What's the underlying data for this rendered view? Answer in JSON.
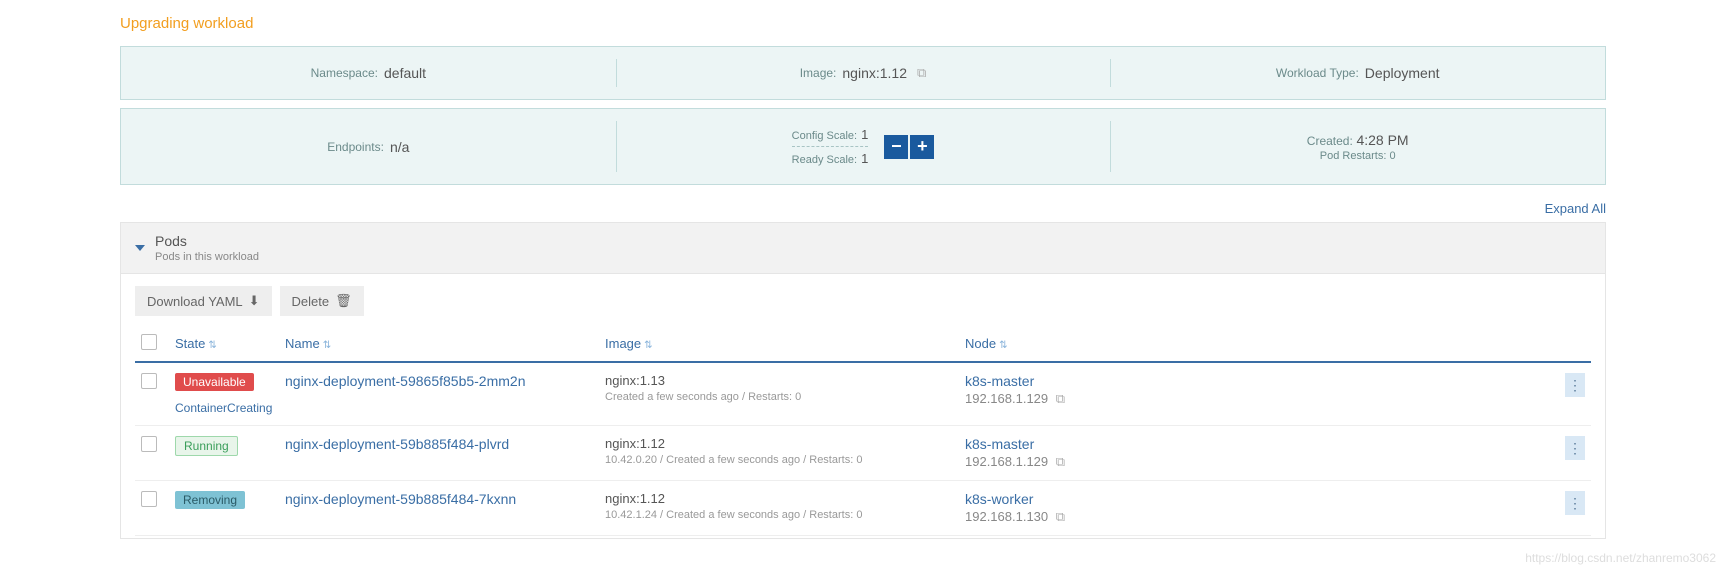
{
  "status": "Upgrading workload",
  "summary1": {
    "namespace_label": "Namespace:",
    "namespace_value": "default",
    "image_label": "Image:",
    "image_value": "nginx:1.12",
    "workload_type_label": "Workload Type:",
    "workload_type_value": "Deployment"
  },
  "summary2": {
    "endpoints_label": "Endpoints:",
    "endpoints_value": "n/a",
    "config_scale_label": "Config Scale:",
    "config_scale_value": "1",
    "ready_scale_label": "Ready Scale:",
    "ready_scale_value": "1",
    "created_label": "Created:",
    "created_value": "4:28 PM",
    "pod_restarts_label": "Pod Restarts:",
    "pod_restarts_value": "0"
  },
  "expand_all": "Expand All",
  "section": {
    "title": "Pods",
    "subtitle": "Pods in this workload"
  },
  "toolbar": {
    "download": "Download YAML",
    "delete": "Delete"
  },
  "headers": {
    "state": "State",
    "name": "Name",
    "image": "Image",
    "node": "Node"
  },
  "pods": [
    {
      "state": "Unavailable",
      "state_class": "unavailable",
      "name": "nginx-deployment-59865f85b5-2mm2n",
      "sub_status": "ContainerCreating",
      "image": "nginx:1.13",
      "meta": "Created a few seconds ago / Restarts: 0",
      "node_name": "k8s-master",
      "node_ip": "192.168.1.129"
    },
    {
      "state": "Running",
      "state_class": "running",
      "name": "nginx-deployment-59b885f484-plvrd",
      "sub_status": "",
      "image": "nginx:1.12",
      "meta": "10.42.0.20 / Created a few seconds ago / Restarts: 0",
      "node_name": "k8s-master",
      "node_ip": "192.168.1.129"
    },
    {
      "state": "Removing",
      "state_class": "removing",
      "name": "nginx-deployment-59b885f484-7kxnn",
      "sub_status": "",
      "image": "nginx:1.12",
      "meta": "10.42.1.24 / Created a few seconds ago / Restarts: 0",
      "node_name": "k8s-worker",
      "node_ip": "192.168.1.130"
    }
  ],
  "watermark": "https://blog.csdn.net/zhanremo3062"
}
